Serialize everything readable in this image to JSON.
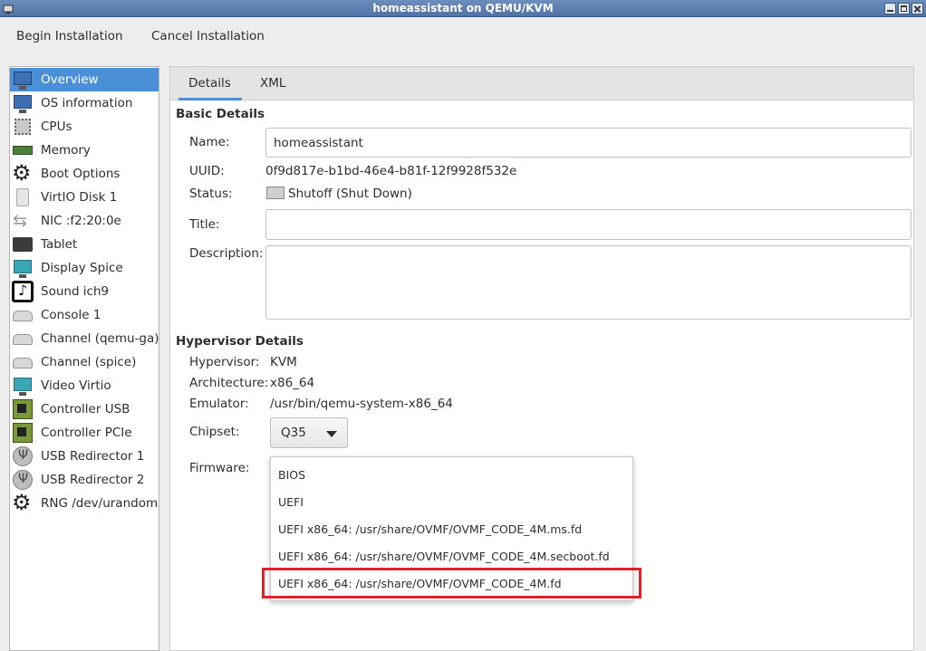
{
  "window": {
    "title": "homeassistant on QEMU/KVM"
  },
  "toolbar": {
    "begin_label": "Begin Installation",
    "cancel_label": "Cancel Installation"
  },
  "sidebar": {
    "items": [
      {
        "label": "Overview",
        "icon": "monitor-icon"
      },
      {
        "label": "OS information",
        "icon": "monitor-icon"
      },
      {
        "label": "CPUs",
        "icon": "cpu-icon"
      },
      {
        "label": "Memory",
        "icon": "memory-icon"
      },
      {
        "label": "Boot Options",
        "icon": "gear-icon"
      },
      {
        "label": "VirtIO Disk 1",
        "icon": "disk-icon"
      },
      {
        "label": "NIC :f2:20:0e",
        "icon": "network-icon"
      },
      {
        "label": "Tablet",
        "icon": "tablet-icon"
      },
      {
        "label": "Display Spice",
        "icon": "display-icon"
      },
      {
        "label": "Sound ich9",
        "icon": "sound-icon"
      },
      {
        "label": "Console 1",
        "icon": "console-icon"
      },
      {
        "label": "Channel (qemu-ga)",
        "icon": "channel-icon"
      },
      {
        "label": "Channel (spice)",
        "icon": "channel-icon"
      },
      {
        "label": "Video Virtio",
        "icon": "display-icon"
      },
      {
        "label": "Controller USB",
        "icon": "controller-icon"
      },
      {
        "label": "Controller PCIe",
        "icon": "controller-icon"
      },
      {
        "label": "USB Redirector 1",
        "icon": "usb-icon"
      },
      {
        "label": "USB Redirector 2",
        "icon": "usb-icon"
      },
      {
        "label": "RNG /dev/urandom",
        "icon": "gear-icon"
      }
    ]
  },
  "tabs": {
    "details": "Details",
    "xml": "XML"
  },
  "basic": {
    "heading": "Basic Details",
    "name_label": "Name:",
    "name_value": "homeassistant",
    "uuid_label": "UUID:",
    "uuid_value": "0f9d817e-b1bd-46e4-b81f-12f9928f532e",
    "status_label": "Status:",
    "status_value": "Shutoff (Shut Down)",
    "title_label": "Title:",
    "title_value": "",
    "description_label": "Description:",
    "description_value": ""
  },
  "hypervisor": {
    "heading": "Hypervisor Details",
    "hypervisor_label": "Hypervisor:",
    "hypervisor_value": "KVM",
    "arch_label": "Architecture:",
    "arch_value": "x86_64",
    "emulator_label": "Emulator:",
    "emulator_value": "/usr/bin/qemu-system-x86_64",
    "chipset_label": "Chipset:",
    "chipset_value": "Q35",
    "firmware_label": "Firmware:"
  },
  "firmware_options": [
    "BIOS",
    "UEFI",
    "UEFI x86_64: /usr/share/OVMF/OVMF_CODE_4M.ms.fd",
    "UEFI x86_64: /usr/share/OVMF/OVMF_CODE_4M.secboot.fd",
    "UEFI x86_64: /usr/share/OVMF/OVMF_CODE_4M.fd"
  ],
  "colors": {
    "selection": "#4a90d9",
    "highlight_box": "#e0202a"
  }
}
